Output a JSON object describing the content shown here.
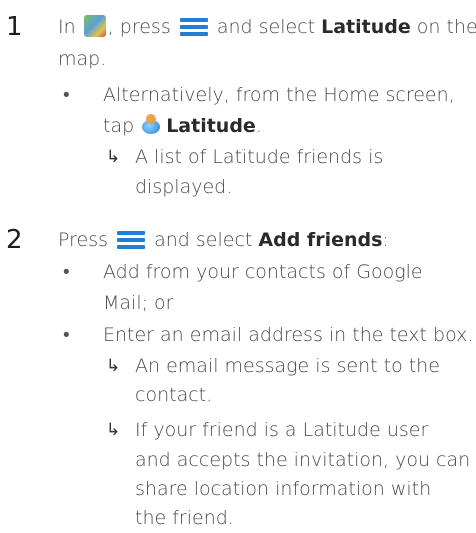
{
  "step1": {
    "number": "1",
    "line1_a": "In",
    "line1_b": ", press",
    "line1_c": "and select",
    "line1_bold": "Latitude",
    "line1_d": "on the",
    "line2": "map.",
    "bullet": "•",
    "bullet1_line1": "Alternatively, from the Home screen,",
    "bullet1_line2_a": "tap",
    "bullet1_line2_bold": "Latitude",
    "bullet1_line2_b": ".",
    "arrow": "↳",
    "result_line1": "A list of Latitude friends is",
    "result_line2": "displayed."
  },
  "step2": {
    "number": "2",
    "line1_a": "Press",
    "line1_b": "and select",
    "line1_bold": "Add friends",
    "line1_c": ":",
    "bullet": "•",
    "bullet1_line1": "Add from your contacts of Google",
    "bullet1_line2": "Mail; or",
    "bullet2_line1": "Enter an email address in the text box.",
    "arrow": "↳",
    "result1_line1": "An email message is sent to the",
    "result1_line2": "contact.",
    "result2_line1": "If your friend is a Latitude user",
    "result2_line2": "and accepts the invitation, you can",
    "result2_line3": "share location information with",
    "result2_line4": "the friend."
  },
  "icons": {
    "menu": "menu-icon",
    "maps_app": "maps-app-icon",
    "latitude_app": "latitude-app-icon",
    "menu_color": "#1f7ed6"
  }
}
